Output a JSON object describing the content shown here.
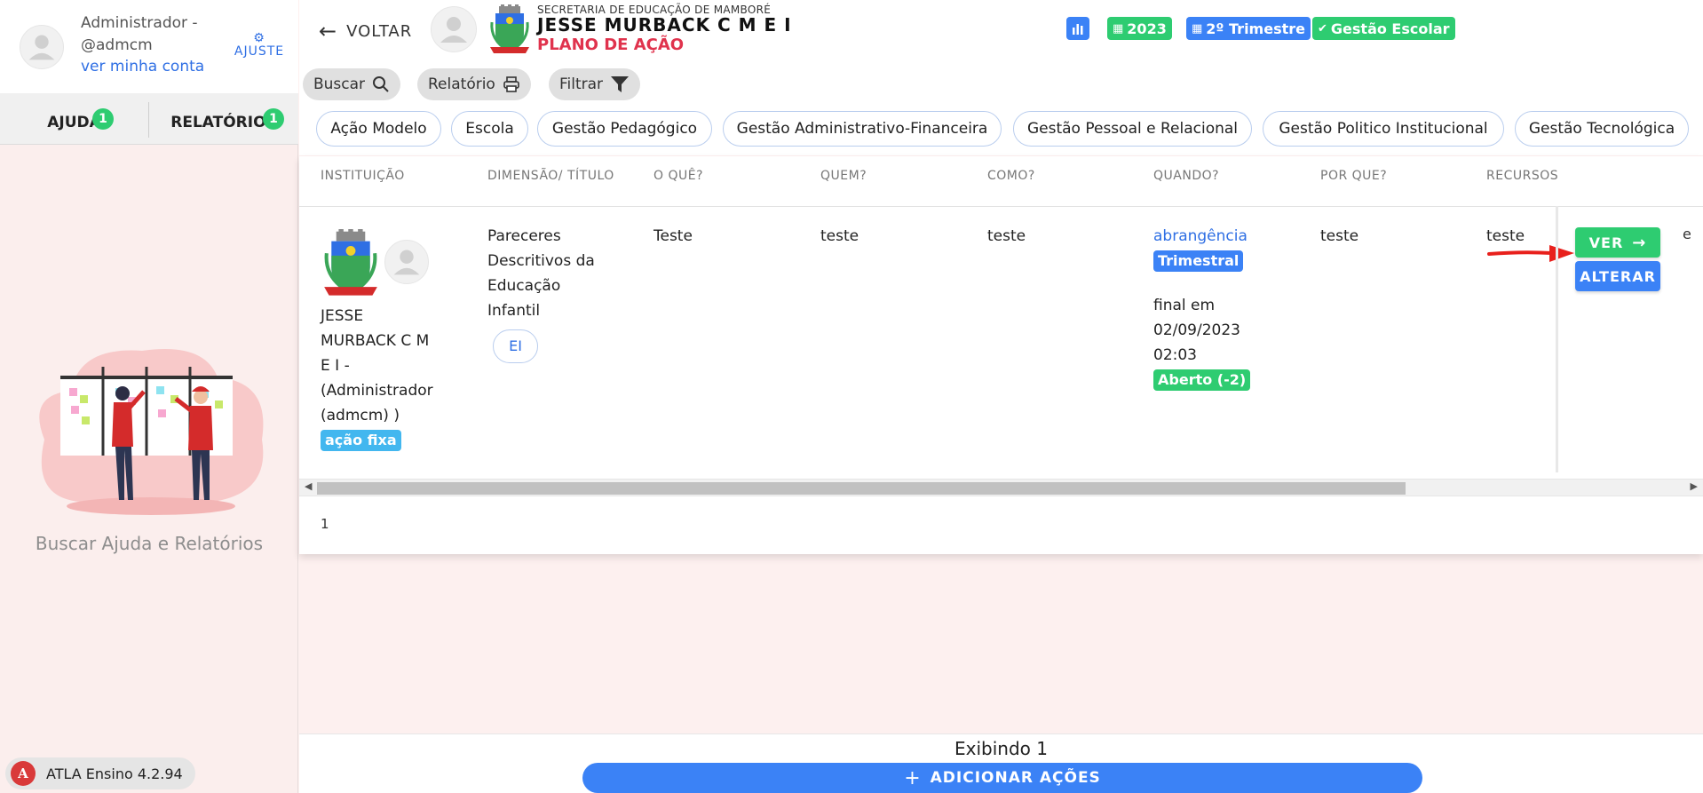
{
  "colors": {
    "primary": "#3b82f6",
    "success": "#2ecc71",
    "info": "#43b7ef",
    "danger": "#e0334d",
    "link": "#2f6fe4"
  },
  "sidebar": {
    "user_name_line1": "Administrador -",
    "user_name_line2": "@admcm",
    "account_link": "ver minha conta",
    "settings_icon": "gear-icon",
    "settings_label": "AJUSTE",
    "tabs": [
      {
        "label": "AJUDA",
        "count": "1"
      },
      {
        "label": "RELATÓRIOS",
        "count": "1"
      }
    ],
    "help_caption": "Buscar Ajuda e Relatórios",
    "version": "ATLA Ensino 4.2.94"
  },
  "header": {
    "back_label": "VOLTAR",
    "subtitle": "SECRETARIA DE EDUCAÇÃO DE MAMBORÉ",
    "title": "JESSE MURBACK C M E I",
    "plan": "PLANO DE AÇÃO",
    "chips": [
      {
        "icon": "bar-chart-icon",
        "label": ""
      },
      {
        "icon": "calendar-icon",
        "label": "2023"
      },
      {
        "icon": "calendar-icon",
        "label": "2º Trimestre"
      },
      {
        "icon": "check-circle-icon",
        "label": "Gestão Escolar"
      }
    ]
  },
  "toolbar": {
    "search_label": "Buscar",
    "report_label": "Relatório",
    "filter_label": "Filtrar"
  },
  "filters": [
    "Ação Modelo",
    "Escola",
    "Gestão Pedagógico",
    "Gestão Administrativo-Financeira",
    "Gestão Pessoal e Relacional",
    "Gestão Politico Institucional",
    "Gestão Tecnológica"
  ],
  "table": {
    "headers": [
      "INSTITUIÇÃO",
      "DIMENSÃO/ TÍTULO",
      "O QUÊ?",
      "QUEM?",
      "COMO?",
      "QUANDO?",
      "POR QUE?",
      "RECURSOS"
    ],
    "row": {
      "institution": [
        "JESSE",
        "MURBACK C M",
        "E I -",
        "(Administrador",
        "(admcm) )"
      ],
      "institution_tag": "ação fixa",
      "dimension": [
        "Pareceres",
        "Descritivos da",
        "Educação",
        "Infantil"
      ],
      "dimension_tag": "EI",
      "what": "Teste",
      "who": "teste",
      "how": "teste",
      "when_link": "abrangência",
      "when_tag": "Trimestral",
      "when_final": [
        "final em",
        "02/09/2023",
        "02:03"
      ],
      "when_status": "Aberto (-2)",
      "why": "teste",
      "resources": "teste",
      "overflow_text": "e",
      "view_label": "VER",
      "edit_label": "ALTERAR"
    },
    "page": "1"
  },
  "footer": {
    "showing": "Exibindo 1",
    "add_label": "ADICIONAR AÇÕES"
  }
}
